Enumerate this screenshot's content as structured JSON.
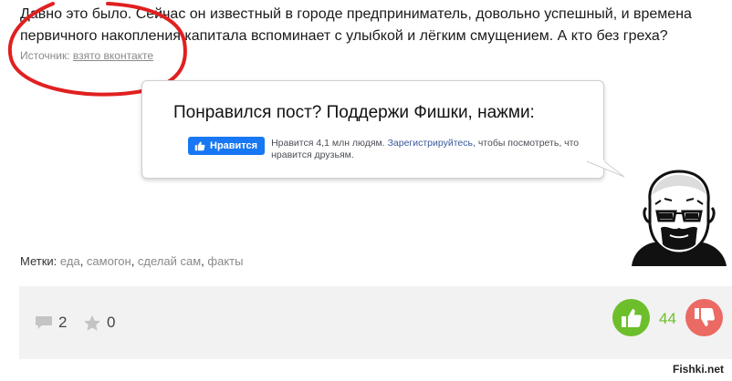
{
  "article": {
    "line1": "Давно это было. Сейчас он известный в городе предприниматель, довольно успешный, и времена",
    "line2": "первичного накопления капитала вспоминает с улыбкой и лёгким смущением. А кто без греха?"
  },
  "source": {
    "label": "Источник:",
    "link_text": "взято вконтакте"
  },
  "support": {
    "title": "Понравился пост? Поддержи Фишки, нажми:",
    "like_button": "Нравится",
    "likes_text": "Нравится 4,1 млн людям.",
    "register_link": "Зарегистрируйтесь,",
    "likes_suffix": "чтобы посмотреть, что нравится друзьям."
  },
  "tags": {
    "label": "Метки:",
    "items": [
      {
        "text": "еда"
      },
      {
        "text": "самогон"
      },
      {
        "text": "сделай сам"
      },
      {
        "text": "факты"
      }
    ]
  },
  "footer": {
    "comments_count": "2",
    "favorites_count": "0",
    "rating": "44",
    "icons": [
      "comment-icon",
      "star-icon",
      "thumbs-up-icon",
      "thumbs-down-icon"
    ],
    "colors": {
      "up": "#6cbf2b",
      "down": "#eb6a63",
      "accent_link": "#385898",
      "fb": "#1877f2",
      "annotation": "#e02020"
    }
  },
  "watermark": "Fishki.net"
}
